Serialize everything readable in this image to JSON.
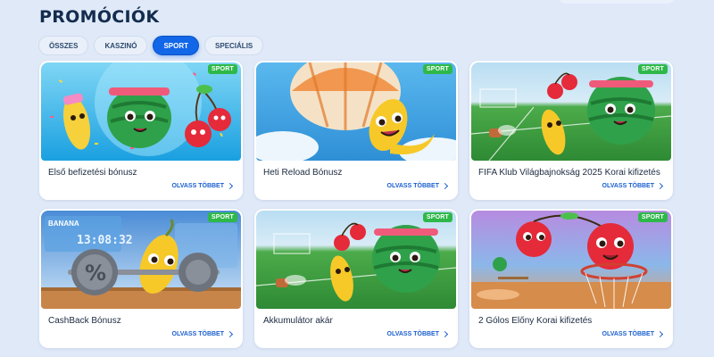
{
  "page_title": "PROMÓCIÓK",
  "tabs": [
    {
      "label": "ÖSSZES",
      "active": false
    },
    {
      "label": "KASZINÓ",
      "active": false
    },
    {
      "label": "SPORT",
      "active": true
    },
    {
      "label": "SPECIÁLIS",
      "active": false
    }
  ],
  "cards": [
    {
      "title": "Első befizetési bónusz",
      "badge": "SPORT",
      "cta": "OLVASS TÖBBET",
      "image": "fruit-party-illustration"
    },
    {
      "title": "Heti Reload Bónusz",
      "badge": "SPORT",
      "cta": "OLVASS TÖBBET",
      "image": "banana-parachute-illustration"
    },
    {
      "title": "FIFA Klub Világbajnokság 2025 Korai kifizetés",
      "badge": "SPORT",
      "cta": "OLVASS TÖBBET",
      "image": "football-field-fruits-illustration"
    },
    {
      "title": "CashBack Bónusz",
      "badge": "SPORT",
      "cta": "OLVASS TÖBBET",
      "image": "banana-barbell-illustration",
      "image_text": {
        "brand": "BANANA",
        "clock": "13:08:32"
      }
    },
    {
      "title": "Akkumulátor akár",
      "badge": "SPORT",
      "cta": "OLVASS TÖBBET",
      "image": "football-field-fruits-illustration"
    },
    {
      "title": "2 Gólos Előny Korai kifizetés",
      "badge": "SPORT",
      "cta": "OLVASS TÖBBET",
      "image": "cherry-basketball-illustration"
    }
  ],
  "colors": {
    "background": "#dfe9f8",
    "accent": "#1266e8",
    "badge": "#2fb84a",
    "link": "#1a5fd0",
    "title": "#142c4d"
  }
}
